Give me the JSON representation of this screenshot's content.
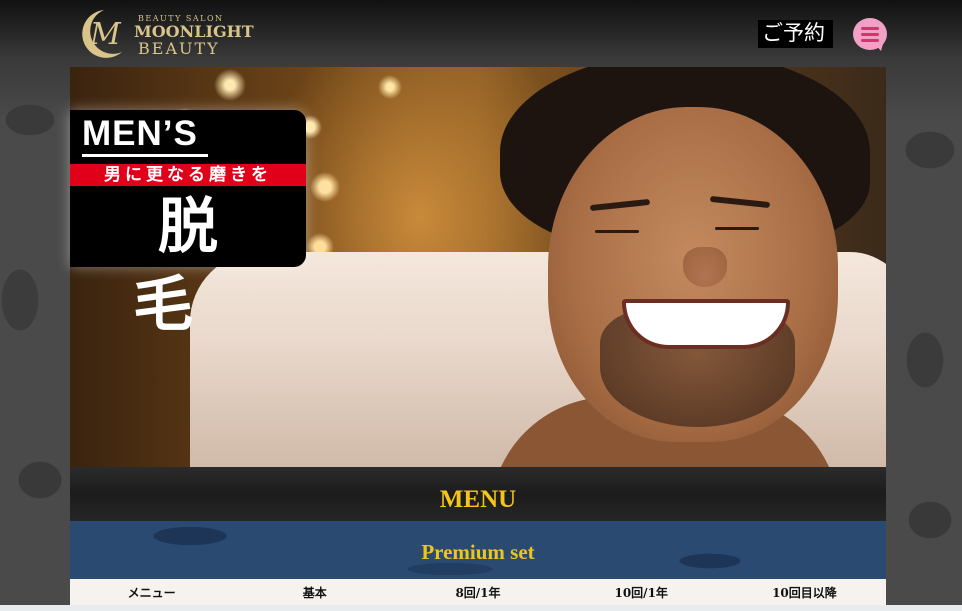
{
  "header": {
    "logo": {
      "small": "BEAUTY SALON",
      "main": "MOONLIGHT",
      "sub": "BEAUTY"
    },
    "reserve_label": "ご予約",
    "menu_icon": "chat-bubble-menu-icon"
  },
  "hero": {
    "badge_title": "MEN’S",
    "badge_tagline": "男に更なる磨きを",
    "badge_main": "脱毛"
  },
  "menu": {
    "title": "MENU",
    "set_title": "Premium set",
    "columns": [
      "メニュー",
      "基本",
      "8回/1年",
      "10回/1年",
      "10回目以降"
    ]
  },
  "colors": {
    "gold": "#d9c48a",
    "menu_title": "#f5c518",
    "badge_red": "#e0001a",
    "premium_band": "#2b4a72",
    "menu_button": "#f2a1c6"
  }
}
